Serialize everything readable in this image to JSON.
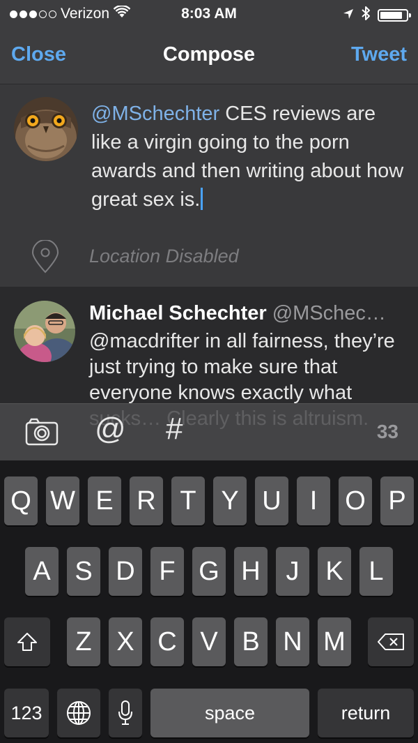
{
  "status_bar": {
    "carrier": "Verizon",
    "time": "8:03 AM"
  },
  "nav": {
    "close_label": "Close",
    "title": "Compose",
    "tweet_label": "Tweet"
  },
  "compose": {
    "mention": "@MSchechter",
    "body": " CES reviews are like a virgin going to the porn awards and then writing about how great sex is.",
    "location": "Location Disabled"
  },
  "reply": {
    "name": "Michael Schechter",
    "handle": "@MSchec…",
    "text": "@macdrifter in all fairness, they’re just trying to make sure that everyone knows exactly what sucks… Clearly this is altruism."
  },
  "toolbar": {
    "at_label": "@",
    "hash_label": "#",
    "char_count": "33"
  },
  "keyboard": {
    "row1": [
      "Q",
      "W",
      "E",
      "R",
      "T",
      "Y",
      "U",
      "I",
      "O",
      "P"
    ],
    "row2": [
      "A",
      "S",
      "D",
      "F",
      "G",
      "H",
      "J",
      "K",
      "L"
    ],
    "row3": [
      "Z",
      "X",
      "C",
      "V",
      "B",
      "N",
      "M"
    ],
    "numbers_label": "123",
    "space_label": "space",
    "return_label": "return"
  },
  "colors": {
    "accent": "#5ea9ef",
    "mention": "#7fb2e8",
    "caret": "#4aa3ff"
  }
}
